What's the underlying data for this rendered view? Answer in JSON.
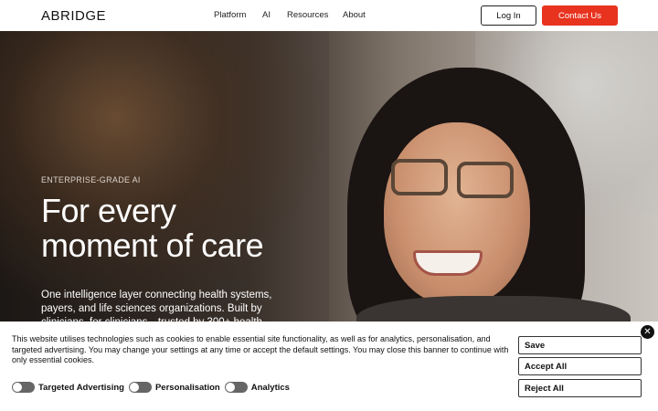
{
  "header": {
    "logo": "ABRIDGE",
    "nav": [
      "Platform",
      "AI",
      "Resources",
      "About"
    ],
    "login_label": "Log In",
    "contact_label": "Contact Us"
  },
  "colors": {
    "accent": "#e8331f",
    "text": "#111111",
    "toggle_off": "#666666"
  },
  "hero": {
    "eyebrow": "ENTERPRISE-GRADE AI",
    "headline_line1": "For every",
    "headline_line2": "moment of care",
    "subtext": "One intelligence layer connecting health systems, payers, and life sciences organizations. Built by clinicians, for clinicians—trusted by 300+ health"
  },
  "cookie_banner": {
    "text": "This website utilises technologies such as cookies to enable essential site functionality, as well as for analytics, personalisation, and targeted advertising. You may change your settings at any time or accept the default settings. You may close this banner to continue with only essential cookies.",
    "toggles": [
      {
        "label": "Targeted Advertising",
        "on": false
      },
      {
        "label": "Personalisation",
        "on": false
      },
      {
        "label": "Analytics",
        "on": false
      }
    ],
    "save_label": "Save",
    "accept_label": "Accept All",
    "reject_label": "Reject All",
    "close_icon": "close-icon"
  }
}
